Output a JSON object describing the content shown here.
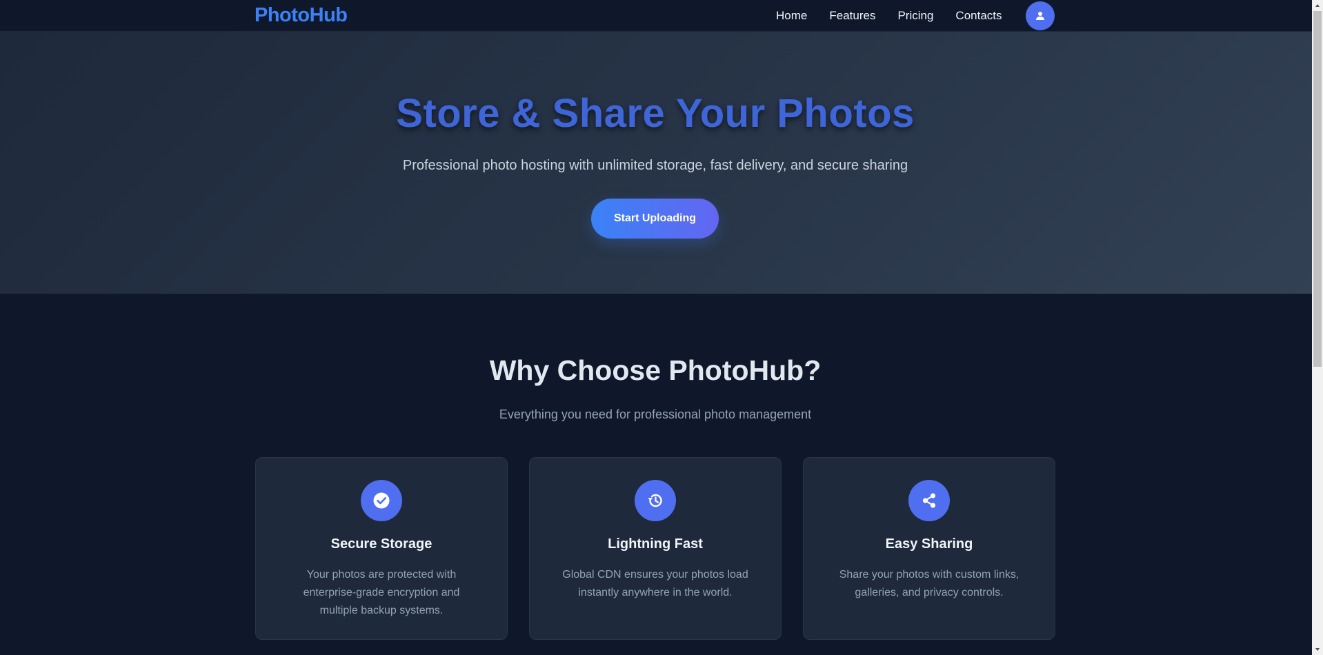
{
  "nav": {
    "brand": "PhotoHub",
    "links": [
      "Home",
      "Features",
      "Pricing",
      "Contacts"
    ],
    "avatar_icon": "user-icon"
  },
  "hero": {
    "title": "Store & Share Your Photos",
    "subtitle": "Professional photo hosting with unlimited storage, fast delivery, and secure sharing",
    "cta_label": "Start Uploading"
  },
  "features": {
    "title": "Why Choose PhotoHub?",
    "subtitle": "Everything you need for professional photo management",
    "cards": [
      {
        "icon": "check-circle-icon",
        "title": "Secure Storage",
        "desc": "Your photos are protected with enterprise-grade encryption and multiple backup systems."
      },
      {
        "icon": "history-icon",
        "title": "Lightning Fast",
        "desc": "Global CDN ensures your photos load instantly anywhere in the world."
      },
      {
        "icon": "share-icon",
        "title": "Easy Sharing",
        "desc": "Share your photos with custom links, galleries, and privacy controls."
      }
    ]
  },
  "colors": {
    "accent": "#3b82f6",
    "accent_secondary": "#6366f1",
    "page_background": "#0f172a",
    "card_background": "#1e293b"
  }
}
